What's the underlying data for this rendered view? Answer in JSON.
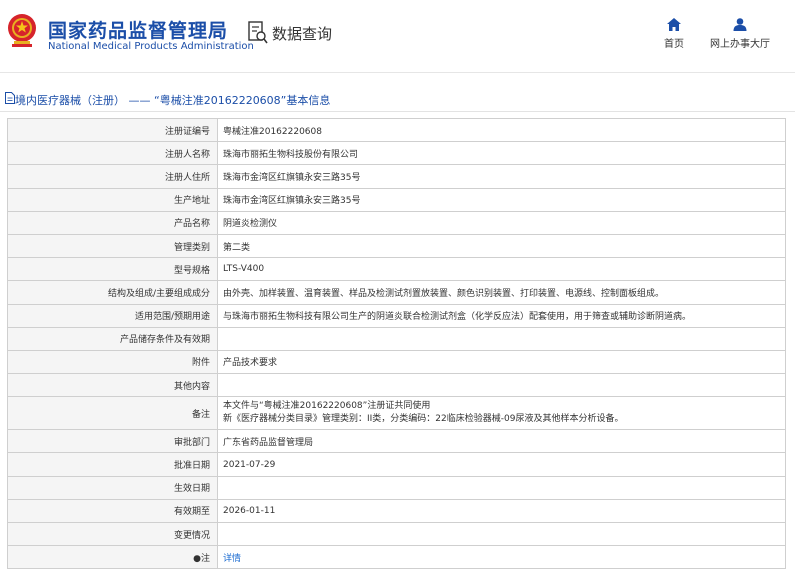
{
  "header": {
    "brand_cn": "国家药品监督管理局",
    "brand_en": "National Medical Products Administration",
    "query_label": "数据查询",
    "nav": {
      "home_label": "首页",
      "hall_label": "网上办事大厅"
    },
    "icons": {
      "emblem": "national-emblem-icon",
      "query": "search-document-icon",
      "home": "home-icon",
      "hall": "user-icon"
    },
    "colors": {
      "brand": "#1b4ea8",
      "link": "#1b6bd1"
    }
  },
  "breadcrumb": {
    "section": "境内医疗器械（注册）",
    "separator": "——",
    "title": "“粤械注准20162220608”基本信息"
  },
  "record": {
    "rows": [
      {
        "label": "注册证编号",
        "value": "粤械注准20162220608"
      },
      {
        "label": "注册人名称",
        "value": "珠海市丽拓生物科技股份有限公司"
      },
      {
        "label": "注册人住所",
        "value": "珠海市金湾区红旗镇永安三路35号"
      },
      {
        "label": "生产地址",
        "value": "珠海市金湾区红旗镇永安三路35号"
      },
      {
        "label": "产品名称",
        "value": "阴道炎检测仪"
      },
      {
        "label": "管理类别",
        "value": "第二类"
      },
      {
        "label": "型号规格",
        "value": "LTS-V400"
      },
      {
        "label": "结构及组成/主要组成成分",
        "value": "由外壳、加样装置、温育装置、样品及检测试剂置放装置、颜色识别装置、打印装置、电源线、控制面板组成。"
      },
      {
        "label": "适用范围/预期用途",
        "value": "与珠海市丽拓生物科技有限公司生产的阴道炎联合检测试剂盒（化学反应法）配套使用，用于筛查或辅助诊断阴道病。"
      },
      {
        "label": "产品储存条件及有效期",
        "value": ""
      },
      {
        "label": "附件",
        "value": "产品技术要求"
      },
      {
        "label": "其他内容",
        "value": ""
      },
      {
        "label": "备注",
        "value": "",
        "lines": [
          "本文件与“粤械注准20162220608”注册证共同使用",
          "新《医疗器械分类目录》管理类别：II类，分类编码：22临床检验器械-09尿液及其他样本分析设备。"
        ]
      },
      {
        "label": "审批部门",
        "value": "广东省药品监督管理局"
      },
      {
        "label": "批准日期",
        "value": "2021-07-29"
      },
      {
        "label": "生效日期",
        "value": ""
      },
      {
        "label": "有效期至",
        "value": "2026-01-11"
      },
      {
        "label": "变更情况",
        "value": ""
      },
      {
        "label": "●注",
        "value": "详情",
        "link": true
      }
    ]
  }
}
